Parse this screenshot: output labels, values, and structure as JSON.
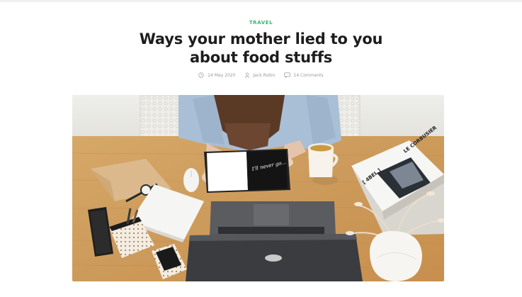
{
  "post": {
    "category": "TRAVEL",
    "title_line1": "Ways your mother lied to you",
    "title_line2": "about food stuffs",
    "meta": {
      "date": "24 May 2020",
      "author": "Jack Robin",
      "comments": "14 Comments"
    },
    "hero_image": {
      "book_cover_text": "LE CORBUSIER",
      "book_spine_text": "[ 4BEL ]",
      "notebook_text": "I'll never go..."
    }
  },
  "colors": {
    "accent": "#3bb56f",
    "title": "#1d1d1f",
    "meta": "#9a9a9a"
  },
  "icons": [
    "clock-icon",
    "user-icon",
    "comment-icon"
  ]
}
